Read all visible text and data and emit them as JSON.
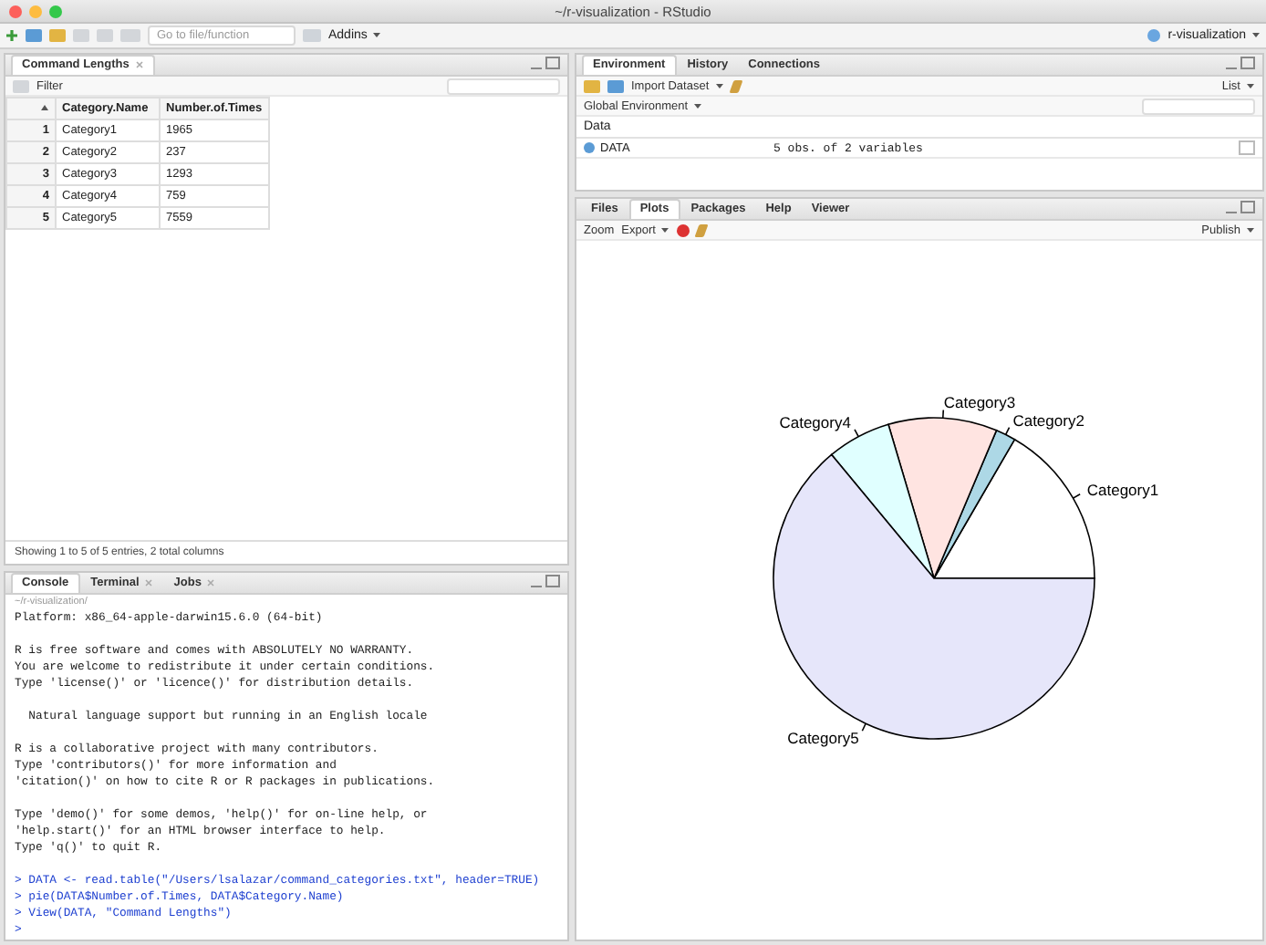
{
  "window": {
    "title": "~/r-visualization - RStudio"
  },
  "toolbar": {
    "goto_placeholder": "Go to file/function",
    "addins": "Addins",
    "project": "r-visualization"
  },
  "source_pane": {
    "tabs": [
      {
        "label": "Command Lengths",
        "selected": true,
        "closable": true
      }
    ],
    "filter": "Filter",
    "table": {
      "columns": [
        "Category.Name",
        "Number.of.Times"
      ],
      "rows": [
        {
          "index": "1",
          "cells": [
            "Category1",
            "1965"
          ]
        },
        {
          "index": "2",
          "cells": [
            "Category2",
            "237"
          ]
        },
        {
          "index": "3",
          "cells": [
            "Category3",
            "1293"
          ]
        },
        {
          "index": "4",
          "cells": [
            "Category4",
            "759"
          ]
        },
        {
          "index": "5",
          "cells": [
            "Category5",
            "7559"
          ]
        }
      ]
    },
    "footer": "Showing 1 to 5 of 5 entries, 2 total columns"
  },
  "console_pane": {
    "tabs": [
      {
        "label": "Console",
        "selected": true,
        "closable": false
      },
      {
        "label": "Terminal",
        "selected": false,
        "closable": true
      },
      {
        "label": "Jobs",
        "selected": false,
        "closable": true
      }
    ],
    "path": "~/r-visualization/",
    "lines": [
      {
        "kind": "output",
        "text": "Platform: x86_64-apple-darwin15.6.0 (64-bit)"
      },
      {
        "kind": "gap"
      },
      {
        "kind": "output",
        "text": "R is free software and comes with ABSOLUTELY NO WARRANTY."
      },
      {
        "kind": "output",
        "text": "You are welcome to redistribute it under certain conditions."
      },
      {
        "kind": "output",
        "text": "Type 'license()' or 'licence()' for distribution details."
      },
      {
        "kind": "gap"
      },
      {
        "kind": "output",
        "text": "  Natural language support but running in an English locale"
      },
      {
        "kind": "gap"
      },
      {
        "kind": "output",
        "text": "R is a collaborative project with many contributors."
      },
      {
        "kind": "output",
        "text": "Type 'contributors()' for more information and"
      },
      {
        "kind": "output",
        "text": "'citation()' on how to cite R or R packages in publications."
      },
      {
        "kind": "gap"
      },
      {
        "kind": "output",
        "text": "Type 'demo()' for some demos, 'help()' for on-line help, or"
      },
      {
        "kind": "output",
        "text": "'help.start()' for an HTML browser interface to help."
      },
      {
        "kind": "output",
        "text": "Type 'q()' to quit R."
      },
      {
        "kind": "gap"
      },
      {
        "kind": "input",
        "text": "> DATA <- read.table(\"/Users/lsalazar/command_categories.txt\", header=TRUE)"
      },
      {
        "kind": "input",
        "text": "> pie(DATA$Number.of.Times, DATA$Category.Name)"
      },
      {
        "kind": "input",
        "text": "> View(DATA, \"Command Lengths\")"
      },
      {
        "kind": "input",
        "text": ">"
      }
    ]
  },
  "env_pane": {
    "tabs": [
      {
        "label": "Environment",
        "selected": true
      },
      {
        "label": "History",
        "selected": false
      },
      {
        "label": "Connections",
        "selected": false
      }
    ],
    "import_dataset": "Import Dataset",
    "list_view": "List",
    "environment": "Global Environment",
    "section": "Data",
    "rows": [
      {
        "name": "DATA",
        "value": "5 obs. of 2 variables"
      }
    ]
  },
  "files_pane": {
    "tabs": [
      {
        "label": "Files",
        "selected": false
      },
      {
        "label": "Plots",
        "selected": true
      },
      {
        "label": "Packages",
        "selected": false
      },
      {
        "label": "Help",
        "selected": false
      },
      {
        "label": "Viewer",
        "selected": false
      }
    ],
    "zoom": "Zoom",
    "export": "Export",
    "publish": "Publish",
    "chart_data": {
      "type": "pie",
      "categories": [
        "Category1",
        "Category2",
        "Category3",
        "Category4",
        "Category5"
      ],
      "values": [
        16.63,
        2.01,
        10.95,
        6.42,
        63.99
      ],
      "colors": [
        "#ffffff",
        "#add8e6",
        "#ffe4e1",
        "#e0ffff",
        "#e6e6fa"
      ]
    }
  }
}
